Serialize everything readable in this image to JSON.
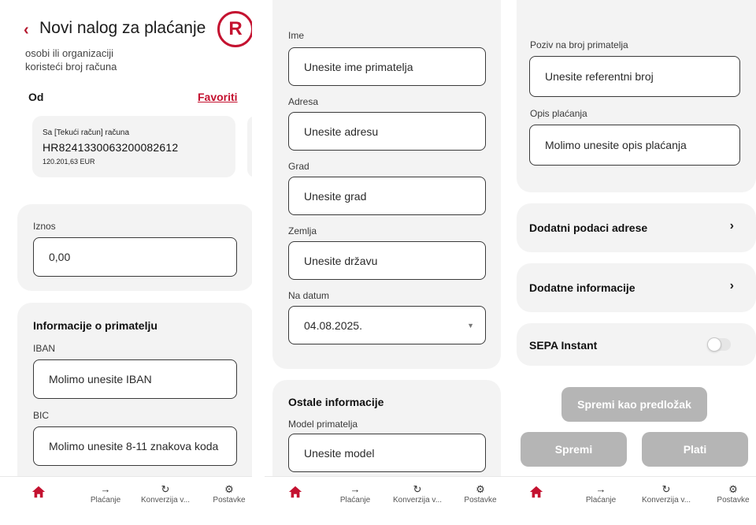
{
  "panel1": {
    "title": "Novi nalog za plaćanje",
    "subtitle_line1": "osobi ili organizaciji",
    "subtitle_line2": "koristeći broj računa",
    "from_label": "Od",
    "favorites_link": "Favoriti",
    "account": {
      "name": "Sa [Tekući račun] računa",
      "iban": "HR8241330063200082612",
      "balance": "120.201,63 EUR"
    },
    "amount_label": "Iznos",
    "amount_value": "0,00",
    "recipient_section_title": "Informacije o primatelju",
    "iban_label": "IBAN",
    "iban_placeholder": "Molimo unesite IBAN",
    "bic_label": "BIC",
    "bic_placeholder": "Molimo unesite 8-11 znakova koda"
  },
  "panel2": {
    "name_label": "Ime",
    "name_placeholder": "Unesite ime primatelja",
    "address_label": "Adresa",
    "address_placeholder": "Unesite adresu",
    "city_label": "Grad",
    "city_placeholder": "Unesite grad",
    "country_label": "Zemlja",
    "country_placeholder": "Unesite državu",
    "date_label": "Na datum",
    "date_value": "04.08.2025.",
    "other_section_title": "Ostale informacije",
    "model_label": "Model primatelja",
    "model_placeholder": "Unesite model"
  },
  "panel3": {
    "reference_label": "Poziv na broj primatelja",
    "reference_placeholder": "Unesite referentni broj",
    "description_label": "Opis plaćanja",
    "description_placeholder": "Molimo unesite opis plaćanja",
    "additional_address": "Dodatni podaci adrese",
    "additional_info": "Dodatne informacije",
    "sepa_instant": "SEPA Instant",
    "sepa_instant_on": false,
    "save_template_button": "Spremi kao predložak",
    "save_button": "Spremi",
    "pay_button": "Plati"
  },
  "tabbar": {
    "payments": "Plaćanje",
    "conversion": "Konverzija v...",
    "settings": "Postavke"
  },
  "colors": {
    "brand": "#c41230",
    "card_bg": "#f3f3f3",
    "disabled_button": "#b5b5b5"
  }
}
